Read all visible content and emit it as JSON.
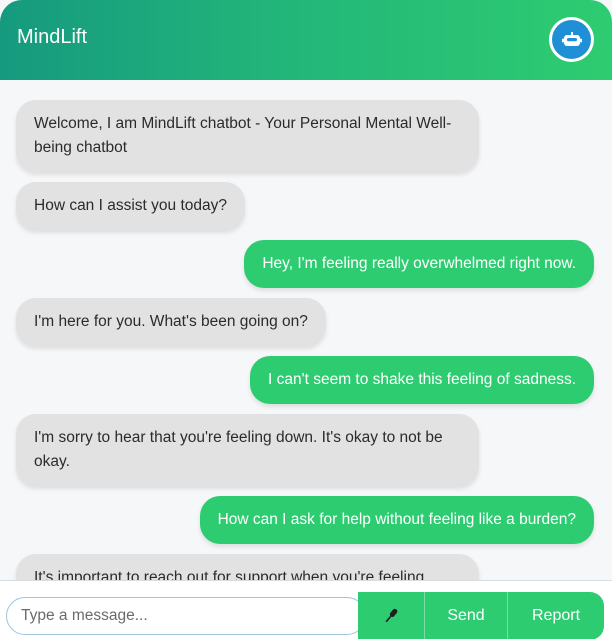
{
  "header": {
    "title": "MindLift",
    "bot_icon": "robot-icon"
  },
  "messages": [
    {
      "sender": "bot",
      "text": "Welcome, I am MindLift chatbot - Your Personal Mental Well-being chatbot"
    },
    {
      "sender": "bot",
      "text": "How can I assist you today?"
    },
    {
      "sender": "user",
      "text": "Hey, I'm feeling really overwhelmed right now."
    },
    {
      "sender": "bot",
      "text": "I'm here for you. What's been going on?"
    },
    {
      "sender": "user",
      "text": "I can't seem to shake this feeling of sadness."
    },
    {
      "sender": "bot",
      "text": "I'm sorry to hear that you're feeling down. It's okay to not be okay."
    },
    {
      "sender": "user",
      "text": "How can I ask for help without feeling like a burden?"
    },
    {
      "sender": "bot",
      "text": "It's important to reach out for support when you're feeling..."
    }
  ],
  "composer": {
    "placeholder": "Type a message...",
    "mic_icon": "microphone-icon",
    "send_label": "Send",
    "report_label": "Report"
  },
  "colors": {
    "accent": "#2ecc71",
    "header_start": "#169a7f",
    "bot_bubble": "#e2e2e2",
    "bot_avatar": "#1f8fd6"
  }
}
